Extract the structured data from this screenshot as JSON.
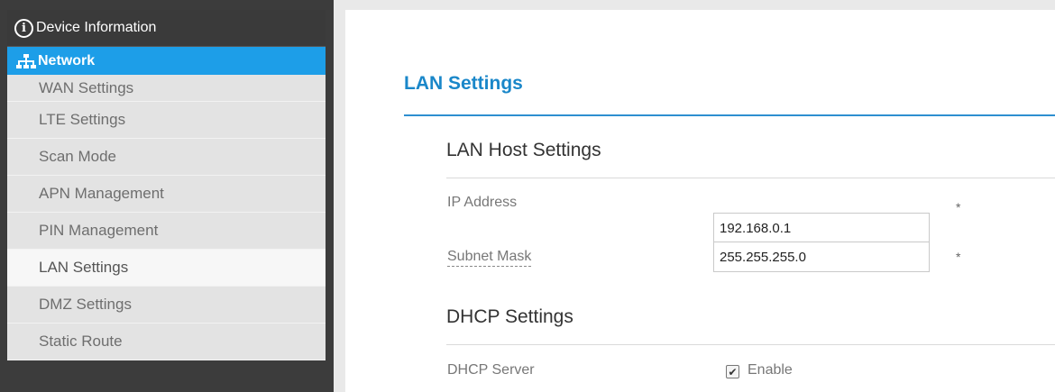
{
  "sidebar": {
    "device_info_label": "Device Information",
    "network_label": "Network",
    "items": [
      {
        "label": "WAN Settings"
      },
      {
        "label": "LTE Settings"
      },
      {
        "label": "Scan Mode"
      },
      {
        "label": "APN Management"
      },
      {
        "label": "PIN Management"
      },
      {
        "label": "LAN Settings",
        "active": true
      },
      {
        "label": "DMZ Settings"
      },
      {
        "label": "Static Route"
      }
    ]
  },
  "main": {
    "page_title": "LAN Settings",
    "lan_host": {
      "title": "LAN Host Settings",
      "ip_label": "IP Address",
      "ip_value": "192.168.0.1",
      "mask_label": "Subnet Mask",
      "mask_value": "255.255.255.0",
      "required_mark": "*"
    },
    "dhcp": {
      "title": "DHCP Settings",
      "server_label": "DHCP Server",
      "enable_label": "Enable",
      "enabled": true
    }
  },
  "colors": {
    "accent": "#1d9ee8",
    "title": "#1a87c9",
    "sidebar_bg": "#3c3c3c"
  },
  "icons": {
    "device_info": "info-circle-icon",
    "network": "network-tree-icon",
    "checkbox": "check-icon"
  }
}
